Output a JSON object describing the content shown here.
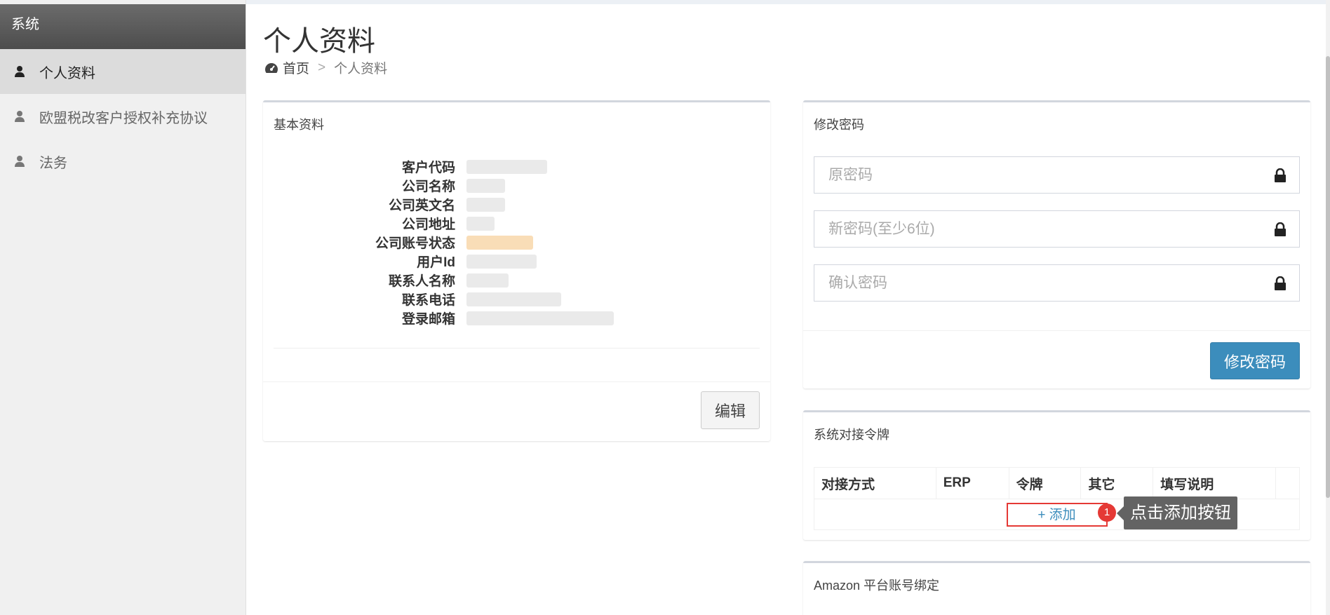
{
  "sidebar": {
    "header": "系统",
    "items": [
      {
        "label": "个人资料"
      },
      {
        "label": "欧盟税改客户授权补充协议"
      },
      {
        "label": "法务"
      }
    ]
  },
  "page": {
    "title": "个人资料",
    "breadcrumb": {
      "home": "首页",
      "sep": ">",
      "current": "个人资料"
    }
  },
  "basic": {
    "title": "基本资料",
    "fields": [
      {
        "label": "客户代码"
      },
      {
        "label": "公司名称"
      },
      {
        "label": "公司英文名"
      },
      {
        "label": "公司地址"
      },
      {
        "label": "公司账号状态"
      },
      {
        "label": "用户Id"
      },
      {
        "label": "联系人名称"
      },
      {
        "label": "联系电话"
      },
      {
        "label": "登录邮箱"
      }
    ],
    "edit_label": "编辑"
  },
  "password": {
    "title": "修改密码",
    "old_placeholder": "原密码",
    "new_placeholder": "新密码(至少6位)",
    "confirm_placeholder": "确认密码",
    "submit_label": "修改密码"
  },
  "token": {
    "title": "系统对接令牌",
    "columns": [
      "对接方式",
      "ERP",
      "令牌",
      "其它",
      "填写说明",
      ""
    ],
    "add_label": "+ 添加",
    "badge": "1",
    "tooltip": "点击添加按钮"
  },
  "amazon": {
    "title": "Amazon 平台账号绑定"
  },
  "colors": {
    "primary": "#3c8dbc",
    "highlight": "#e53935",
    "sidebar_header": "#5a5a5a"
  },
  "icons": {
    "user": "user-icon",
    "dashboard": "dashboard-icon",
    "lock": "lock-icon"
  }
}
